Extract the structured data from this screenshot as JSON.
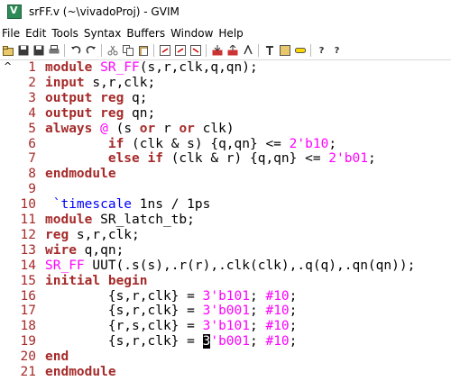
{
  "window": {
    "title": "srFF.v (~\\vivadoProj) - GVIM"
  },
  "menu": [
    "File",
    "Edit",
    "Tools",
    "Syntax",
    "Buffers",
    "Window",
    "Help"
  ],
  "toolbar": {
    "icons": [
      "open-icon",
      "save-icon",
      "save-all-icon",
      "print-icon",
      "undo-icon",
      "redo-icon",
      "cut-icon",
      "copy-icon",
      "paste-icon",
      "find-icon",
      "find-next-icon",
      "find-prev-icon",
      "load-session-icon",
      "save-session-icon",
      "run-script-icon",
      "make-icon",
      "shell-icon",
      "ctags-icon",
      "help-icon",
      "find-help-icon"
    ]
  },
  "editor": {
    "lines": [
      {
        "n": "1",
        "segs": [
          [
            "kw",
            "module "
          ],
          [
            "fn",
            "SR_FF"
          ],
          [
            "id",
            "(s,r,clk,q,qn);"
          ]
        ]
      },
      {
        "n": "2",
        "segs": [
          [
            "kw",
            "input "
          ],
          [
            "id",
            "s,r,clk;"
          ]
        ]
      },
      {
        "n": "3",
        "segs": [
          [
            "kw",
            "output "
          ],
          [
            "kw",
            "reg "
          ],
          [
            "id",
            "q;"
          ]
        ]
      },
      {
        "n": "4",
        "segs": [
          [
            "kw",
            "output "
          ],
          [
            "kw",
            "reg "
          ],
          [
            "id",
            "qn;"
          ]
        ]
      },
      {
        "n": "5",
        "segs": [
          [
            "kw",
            "always "
          ],
          [
            "fn",
            "@ "
          ],
          [
            "id",
            "("
          ],
          [
            "id",
            "s "
          ],
          [
            "kw",
            "or "
          ],
          [
            "id",
            "r "
          ],
          [
            "kw",
            "or "
          ],
          [
            "id",
            "clk)"
          ]
        ]
      },
      {
        "n": "6",
        "segs": [
          [
            "id",
            "        "
          ],
          [
            "kw",
            "if "
          ],
          [
            "id",
            "(clk & s) {q,qn} <= "
          ],
          [
            "num",
            "2'b10"
          ],
          [
            "id",
            ";"
          ]
        ]
      },
      {
        "n": "7",
        "segs": [
          [
            "id",
            "        "
          ],
          [
            "kw",
            "else if "
          ],
          [
            "id",
            "(clk & r) {q,qn} <= "
          ],
          [
            "num",
            "2'b01"
          ],
          [
            "id",
            ";"
          ]
        ]
      },
      {
        "n": "8",
        "segs": [
          [
            "kw",
            "endmodule"
          ]
        ]
      },
      {
        "n": "9",
        "segs": []
      },
      {
        "n": "10",
        "segs": [
          [
            "id",
            " "
          ],
          [
            "pp",
            "`timescale"
          ],
          [
            "id",
            " 1ns / 1ps"
          ]
        ]
      },
      {
        "n": "11",
        "segs": [
          [
            "kw",
            "module "
          ],
          [
            "id",
            "SR_latch_tb;"
          ]
        ]
      },
      {
        "n": "12",
        "segs": [
          [
            "kw",
            "reg "
          ],
          [
            "id",
            "s,r,clk;"
          ]
        ]
      },
      {
        "n": "13",
        "segs": [
          [
            "kw",
            "wire "
          ],
          [
            "id",
            "q,qn;"
          ]
        ]
      },
      {
        "n": "14",
        "segs": [
          [
            "fn",
            "SR_FF "
          ],
          [
            "id",
            "UUT(.s(s),.r(r),.clk(clk),.q(q),.qn(qn));"
          ]
        ]
      },
      {
        "n": "15",
        "segs": [
          [
            "kw",
            "initial "
          ],
          [
            "kw",
            "begin"
          ]
        ]
      },
      {
        "n": "16",
        "segs": [
          [
            "id",
            "        {s,r,clk} = "
          ],
          [
            "num",
            "3'b101"
          ],
          [
            "id",
            "; "
          ],
          [
            "num",
            "#10"
          ],
          [
            "id",
            ";"
          ]
        ]
      },
      {
        "n": "17",
        "segs": [
          [
            "id",
            "        {s,r,clk} = "
          ],
          [
            "num",
            "3'b001"
          ],
          [
            "id",
            "; "
          ],
          [
            "num",
            "#10"
          ],
          [
            "id",
            ";"
          ]
        ]
      },
      {
        "n": "18",
        "segs": [
          [
            "id",
            "        {r,s,clk} = "
          ],
          [
            "num",
            "3'b101"
          ],
          [
            "id",
            "; "
          ],
          [
            "num",
            "#10"
          ],
          [
            "id",
            ";"
          ]
        ]
      },
      {
        "n": "19",
        "segs": [
          [
            "id",
            "        {s,r,clk} = "
          ],
          [
            "cursor",
            "3"
          ],
          [
            "num",
            "'b001"
          ],
          [
            "id",
            "; "
          ],
          [
            "num",
            "#10"
          ],
          [
            "id",
            ";"
          ]
        ]
      },
      {
        "n": "20",
        "segs": [
          [
            "kw",
            "end"
          ]
        ]
      },
      {
        "n": "21",
        "segs": [
          [
            "kw",
            "endmodule"
          ]
        ]
      }
    ]
  },
  "colors": {
    "keyword": "#a52a2a",
    "function": "#ff00ff",
    "preproc": "#0000ff",
    "linenumber": "#a52a2a"
  }
}
